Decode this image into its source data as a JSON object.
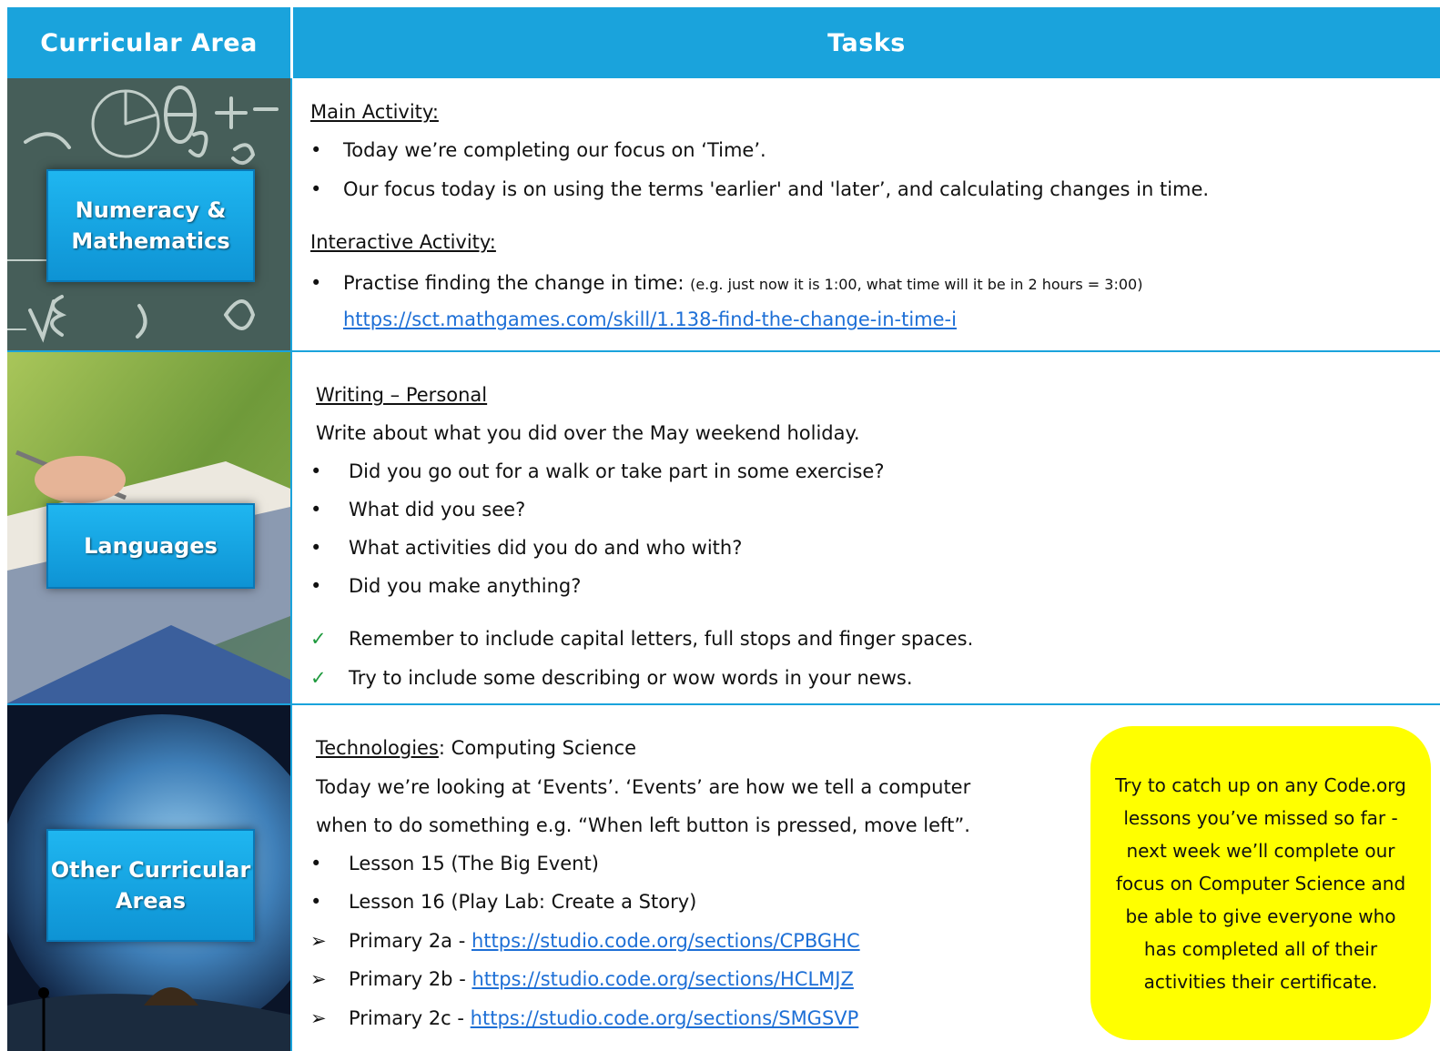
{
  "header": {
    "area_title": "Curricular Area",
    "tasks_title": "Tasks"
  },
  "rows": {
    "numeracy": {
      "area_label": "Numeracy & Mathematics",
      "main_heading": "Main Activity:",
      "bullets": [
        "Today we’re completing our focus on ‘Time’.",
        "Our focus today is on using the terms 'earlier' and 'later’, and calculating changes in time."
      ],
      "interactive_heading": "Interactive Activity:",
      "practise_text": "Practise finding the change in time:",
      "practise_example": "(e.g. just now it is 1:00, what time will it be in 2 hours = 3:00)",
      "link": "https://sct.mathgames.com/skill/1.138-find-the-change-in-time-i"
    },
    "languages": {
      "area_label": "Languages",
      "heading": "Writing – Personal",
      "intro": "Write about what you did over the May weekend holiday.",
      "bullets": [
        "Did you go out for a walk or take part in some exercise?",
        "What did you see?",
        "What activities did you do and who with?",
        "Did you make anything?"
      ],
      "checks": [
        "Remember to include capital letters, full stops and finger spaces.",
        "Try to include some describing or wow words in your news."
      ]
    },
    "other": {
      "area_label": "Other Curricular Areas",
      "heading_underlined": "Technologies",
      "heading_rest": ": Computing Science",
      "intro_line1": "Today we’re looking at ‘Events’. ‘Events’ are how we tell a computer",
      "intro_line2": "when to do something e.g. “When left button is pressed, move left”.",
      "bullets": [
        "Lesson 15 (The Big Event)",
        "Lesson 16 (Play Lab: Create a Story)"
      ],
      "classes": [
        {
          "label": "Primary 2a - ",
          "link": "https://studio.code.org/sections/CPBGHC"
        },
        {
          "label": "Primary 2b - ",
          "link": "https://studio.code.org/sections/HCLMJZ"
        },
        {
          "label": "Primary 2c - ",
          "link": "https://studio.code.org/sections/SMGSVP"
        }
      ],
      "note": "Try to catch up on any Code.org lessons you’ve missed so far - next week we’ll complete our focus on Computer Science and be able to give everyone who has completed all of their activities their certificate."
    }
  },
  "symbols": {
    "bullet": "•",
    "check": "✓",
    "arrow": "➢"
  },
  "colors": {
    "header_bg": "#1aa3dc",
    "label_bg": "#1fb6f0",
    "link": "#1d6fd6",
    "note_bg": "#ffff00",
    "check": "#1f9a3e"
  }
}
